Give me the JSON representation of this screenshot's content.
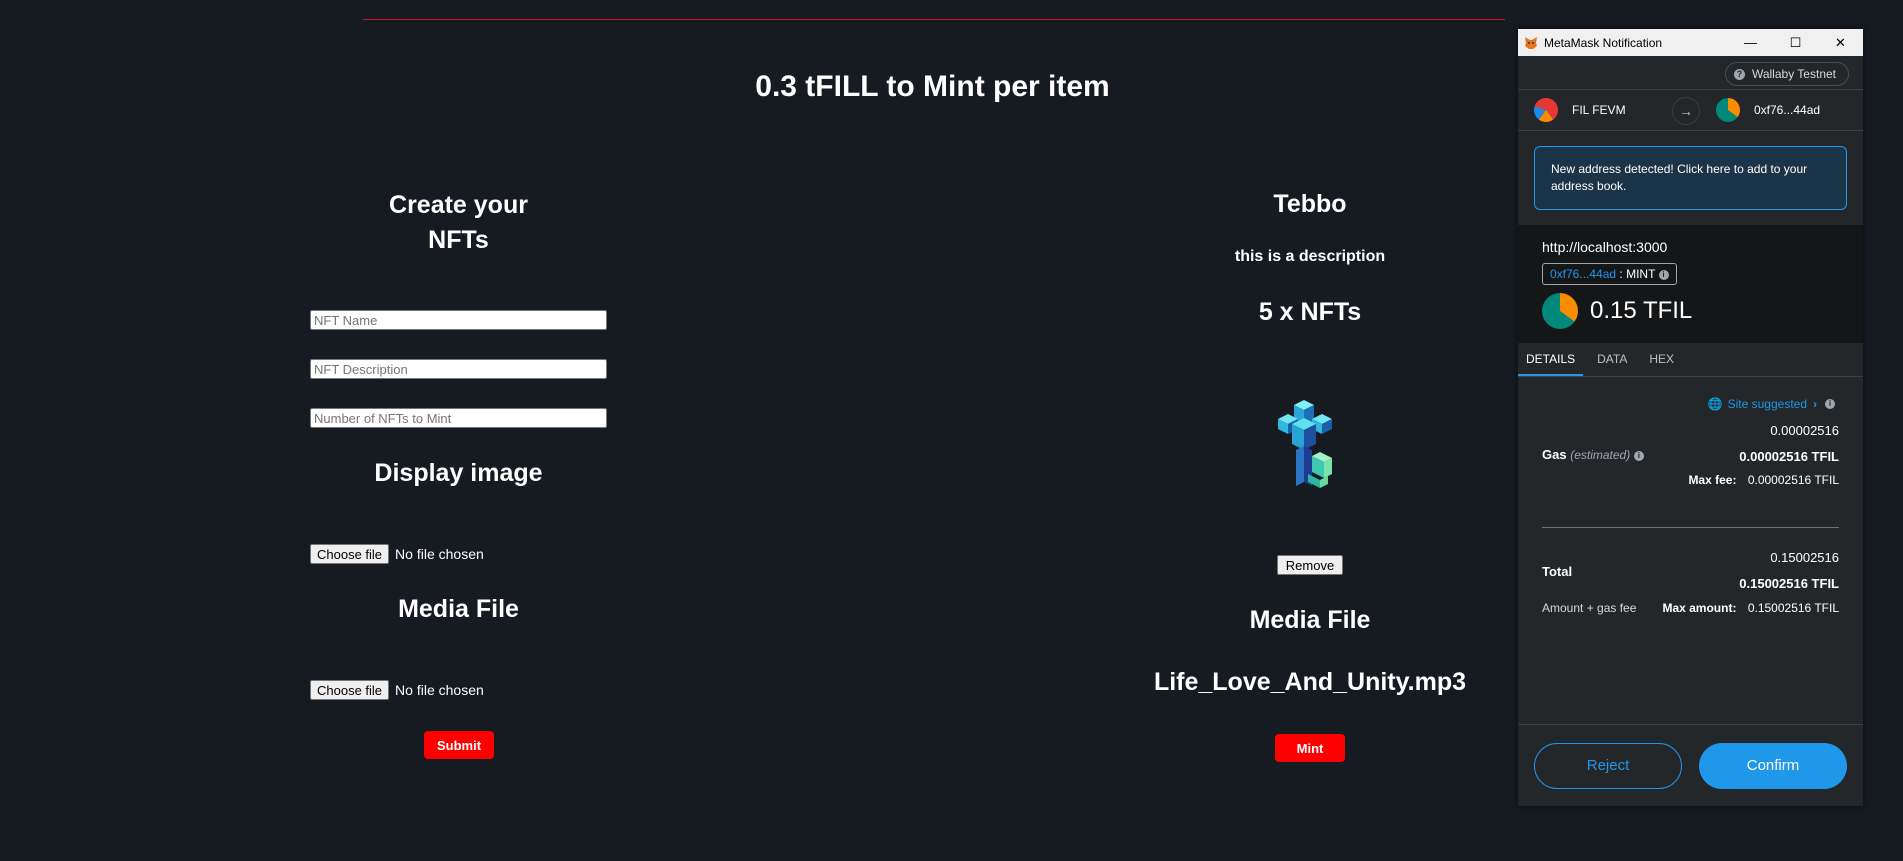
{
  "page": {
    "heading": "0.3 tFILL to Mint per item"
  },
  "create_form": {
    "title_line1": "Create your",
    "title_line2": "NFTs",
    "name_placeholder": "NFT Name",
    "description_placeholder": "NFT Description",
    "count_placeholder": "Number of NFTs to Mint",
    "display_image_label": "Display image",
    "choose_file_label": "Choose file",
    "no_file_text": "No file chosen",
    "media_file_label": "Media File",
    "submit_label": "Submit"
  },
  "preview": {
    "name": "Tebbo",
    "description": "this is a description",
    "quantity_text": "5 x NFTs",
    "remove_label": "Remove",
    "media_file_label": "Media File",
    "media_file_name": "Life_Love_And_Unity.mp3",
    "mint_label": "Mint"
  },
  "metamask": {
    "window_title": "MetaMask Notification",
    "network": "Wallaby Testnet",
    "from_account": "FIL FEVM",
    "to_account": "0xf76...44ad",
    "alert_text": "New address detected! Click here to add to your address book.",
    "origin": "http://localhost:3000",
    "contract_address": "0xf76...44ad",
    "method": ": MINT",
    "amount": "0.15 TFIL",
    "tabs": [
      "DETAILS",
      "DATA",
      "HEX"
    ],
    "site_suggested": "Site suggested",
    "gas_label": "Gas",
    "gas_estimated": "(estimated)",
    "gas_value": "0.00002516",
    "gas_value_bold": "0.00002516 TFIL",
    "max_fee_label": "Max fee:",
    "max_fee_value": "0.00002516 TFIL",
    "total_label": "Total",
    "total_value": "0.15002516",
    "total_value_bold": "0.15002516 TFIL",
    "amount_gas_fee": "Amount + gas fee",
    "max_amount_label": "Max amount:",
    "max_amount_value": "0.15002516 TFIL",
    "reject_label": "Reject",
    "confirm_label": "Confirm"
  },
  "colors": {
    "background": "#161b21",
    "accent_red": "#ff0000",
    "metamask_blue": "#1f98e9"
  }
}
